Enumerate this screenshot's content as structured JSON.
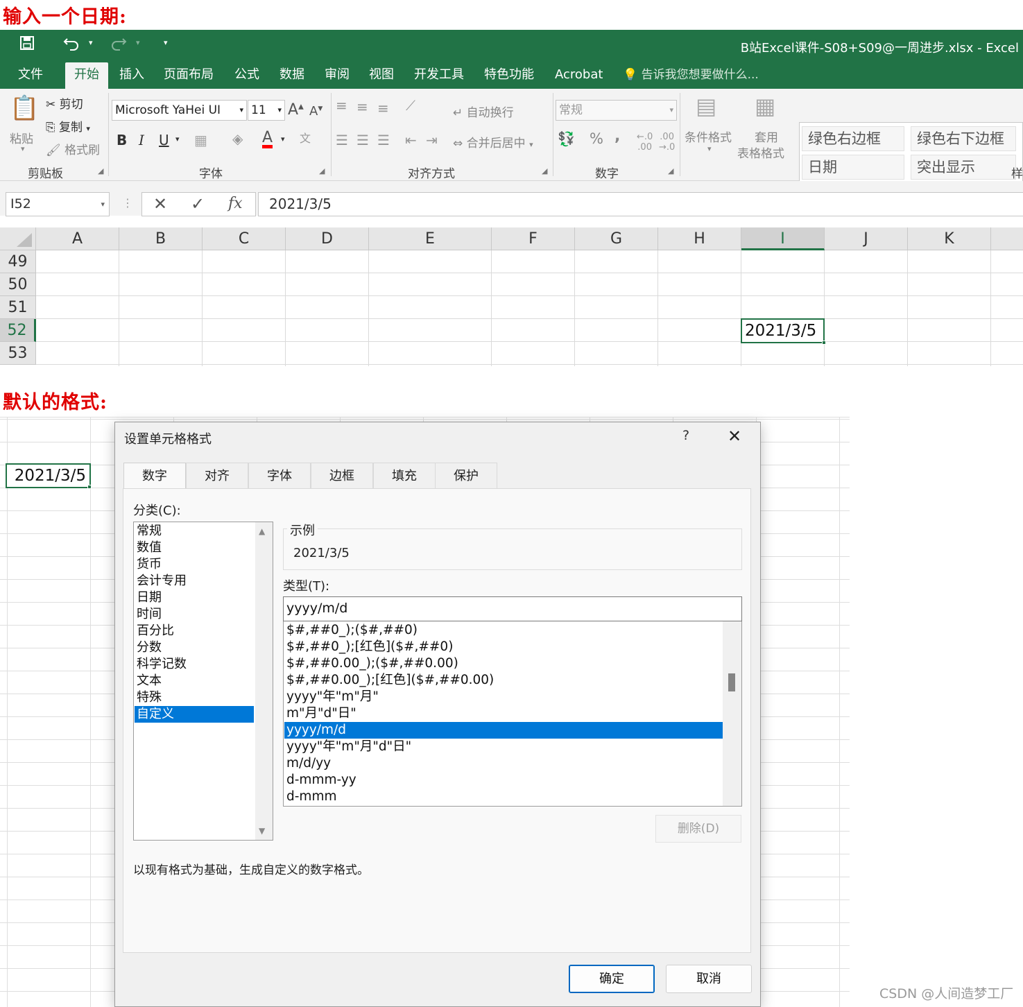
{
  "headings": {
    "input_date": "输入一个日期:",
    "default_format": "默认的格式:"
  },
  "excel": {
    "title": "B站Excel课件-S08+S09@一周进步.xlsx - Excel",
    "menu_tabs": [
      "文件",
      "开始",
      "插入",
      "页面布局",
      "公式",
      "数据",
      "审阅",
      "视图",
      "开发工具",
      "特色功能",
      "Acrobat"
    ],
    "active_tab": "开始",
    "tell_me": "告诉我您想要做什么...",
    "ribbon": {
      "clipboard": {
        "paste": "粘贴",
        "cut": "剪切",
        "copy": "复制",
        "format_painter": "格式刷",
        "label": "剪贴板"
      },
      "font": {
        "name": "Microsoft YaHei UI",
        "size": "11",
        "bold": "B",
        "italic": "I",
        "underline": "U",
        "label": "字体"
      },
      "alignment": {
        "wrap": "自动换行",
        "merge": "合并后居中",
        "label": "对齐方式"
      },
      "number": {
        "format": "常规",
        "percent": "%",
        "comma": ",",
        "label": "数字"
      },
      "styles": {
        "conditional": "条件格式",
        "table_format_1": "套用",
        "table_format_2": "表格格式",
        "cells": [
          "绿色右边框",
          "绿色右下边框",
          "日期",
          "突出显示"
        ],
        "label": "样"
      }
    },
    "name_box": "I52",
    "formula": "2021/3/5",
    "columns": [
      "A",
      "B",
      "C",
      "D",
      "E",
      "F",
      "G",
      "H",
      "I",
      "J",
      "K"
    ],
    "selected_column": "I",
    "rows": [
      "49",
      "50",
      "51",
      "52",
      "53"
    ],
    "selected_row": "52",
    "cell_value": "2021/3/5"
  },
  "sheet_cell_value": "2021/3/5",
  "dialog": {
    "title": "设置单元格格式",
    "help": "?",
    "tabs": [
      "数字",
      "对齐",
      "字体",
      "边框",
      "填充",
      "保护"
    ],
    "active_tab": "数字",
    "category_label": "分类(C):",
    "categories": [
      "常规",
      "数值",
      "货币",
      "会计专用",
      "日期",
      "时间",
      "百分比",
      "分数",
      "科学记数",
      "文本",
      "特殊",
      "自定义"
    ],
    "selected_category": "自定义",
    "sample_label": "示例",
    "sample_value": "2021/3/5",
    "type_label": "类型(T):",
    "type_value": "yyyy/m/d",
    "formats": [
      "$#,##0_);($#,##0)",
      "$#,##0_);[红色]($#,##0)",
      "$#,##0.00_);($#,##0.00)",
      "$#,##0.00_);[红色]($#,##0.00)",
      "yyyy\"年\"m\"月\"",
      "m\"月\"d\"日\"",
      "yyyy/m/d",
      "yyyy\"年\"m\"月\"d\"日\"",
      "m/d/yy",
      "d-mmm-yy",
      "d-mmm"
    ],
    "selected_format": "yyyy/m/d",
    "delete_button": "删除(D)",
    "description": "以现有格式为基础，生成自定义的数字格式。",
    "ok": "确定",
    "cancel": "取消"
  },
  "watermark": "CSDN @人间造梦工厂"
}
